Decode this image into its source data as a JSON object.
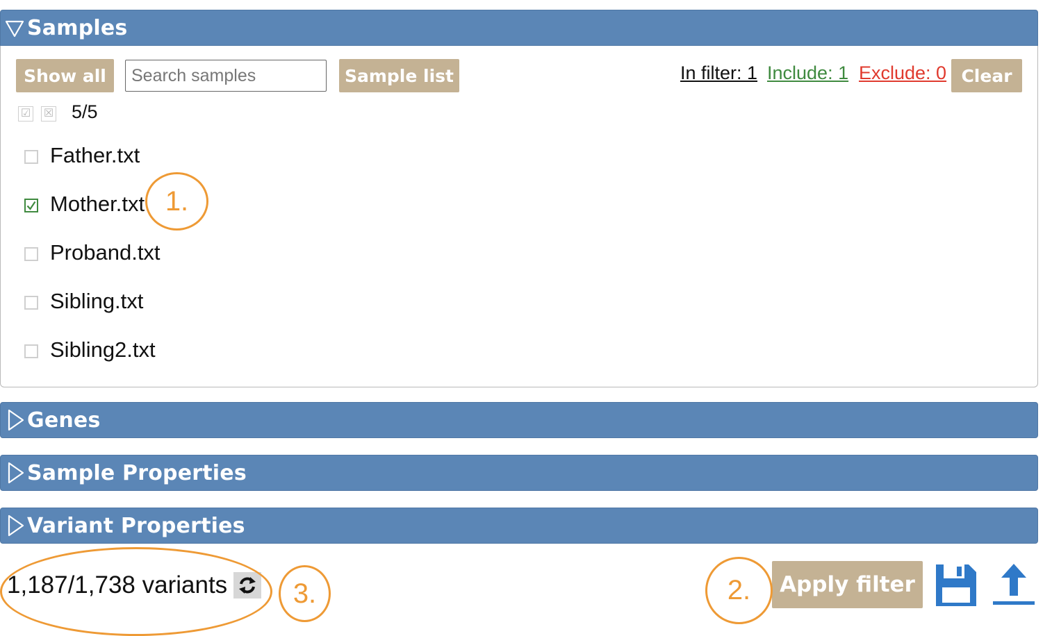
{
  "panels": {
    "samples": {
      "title": "Samples",
      "expanded": true
    },
    "genes": {
      "title": "Genes",
      "expanded": false
    },
    "sample_properties": {
      "title": "Sample Properties",
      "expanded": false
    },
    "variant_properties": {
      "title": "Variant Properties",
      "expanded": false
    }
  },
  "toolbar": {
    "show_all_label": "Show all",
    "search_placeholder": "Search samples",
    "sample_list_label": "Sample list",
    "in_filter": "In filter: 1",
    "include": "Include: 1",
    "exclude": "Exclude: 0",
    "clear_label": "Clear"
  },
  "selection": {
    "check_glyph": "☑",
    "cross_glyph": "☒",
    "count": "5/5"
  },
  "samples": [
    {
      "name": "Father.txt",
      "checked": false
    },
    {
      "name": "Mother.txt",
      "checked": true
    },
    {
      "name": "Proband.txt",
      "checked": false
    },
    {
      "name": "Sibling.txt",
      "checked": false
    },
    {
      "name": "Sibling2.txt",
      "checked": false
    }
  ],
  "footer": {
    "variant_count": "1,187/1,738 variants",
    "apply_filter_label": "Apply filter"
  },
  "annotations": {
    "one": "1.",
    "two": "2.",
    "three": "3."
  },
  "icons": {
    "refresh": "refresh-icon",
    "save": "floppy-disk-icon",
    "upload": "upload-icon"
  },
  "colors": {
    "header_blue": "#5b86b6",
    "tan_button": "#c4b294",
    "include_green": "#3f8a3f",
    "exclude_red": "#e03a2e",
    "annotation_orange": "#ee9a35",
    "icon_blue": "#2f79c8"
  }
}
